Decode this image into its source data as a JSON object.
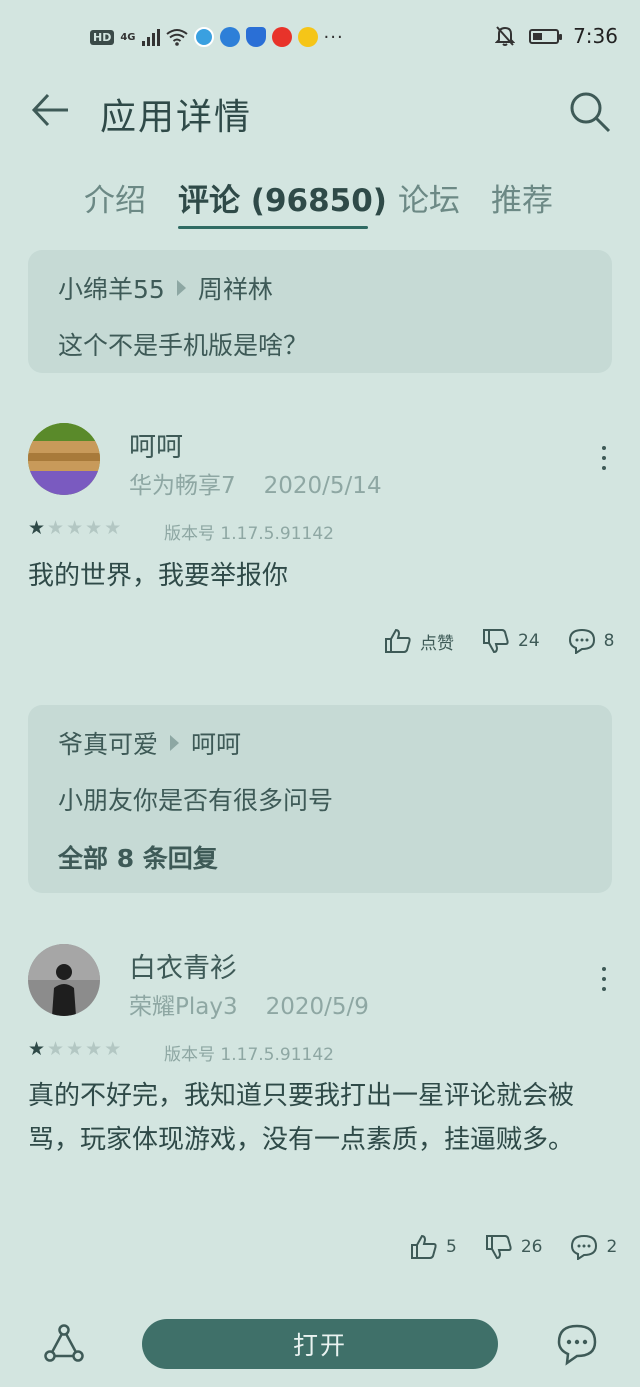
{
  "status_bar": {
    "hd": "HD",
    "network": "4G",
    "time": "7:36"
  },
  "header": {
    "title": "应用详情",
    "back_icon": "back-arrow-icon",
    "search_icon": "search-icon"
  },
  "tabs": [
    {
      "label": "介绍",
      "active": false
    },
    {
      "label": "评论 (96850)",
      "active": true
    },
    {
      "label": "论坛",
      "active": false
    },
    {
      "label": "推荐",
      "active": false
    }
  ],
  "top_reply": {
    "from": "小绵羊55",
    "to": "周祥林",
    "text": "这个不是手机版是啥？"
  },
  "reviews": [
    {
      "name": "呵呵",
      "device": "华为畅享7",
      "date": "2020/5/14",
      "rating": 1,
      "version": "版本号 1.17.5.91142",
      "text": "我的世界，我要举报你",
      "likes": "点赞",
      "dislikes": "24",
      "comments": "8",
      "reply": {
        "from": "爷真可爱",
        "to": "呵呵",
        "text": "小朋友你是否有很多问号",
        "all_replies": "全部 8 条回复"
      }
    },
    {
      "name": "白衣青衫",
      "device": "荣耀Play3",
      "date": "2020/5/9",
      "rating": 1,
      "version": "版本号 1.17.5.91142",
      "text": "真的不好完，我知道只要我打出一星评论就会被骂，玩家体现游戏，没有一点素质，挂逼贼多。",
      "likes": "5",
      "dislikes": "26",
      "comments": "2"
    }
  ],
  "bottom_bar": {
    "open_label": "打开"
  },
  "colors": {
    "background": "#d3e5e0",
    "card": "#c6dad5",
    "accent": "#3f7069",
    "text": "#2f4a48"
  }
}
